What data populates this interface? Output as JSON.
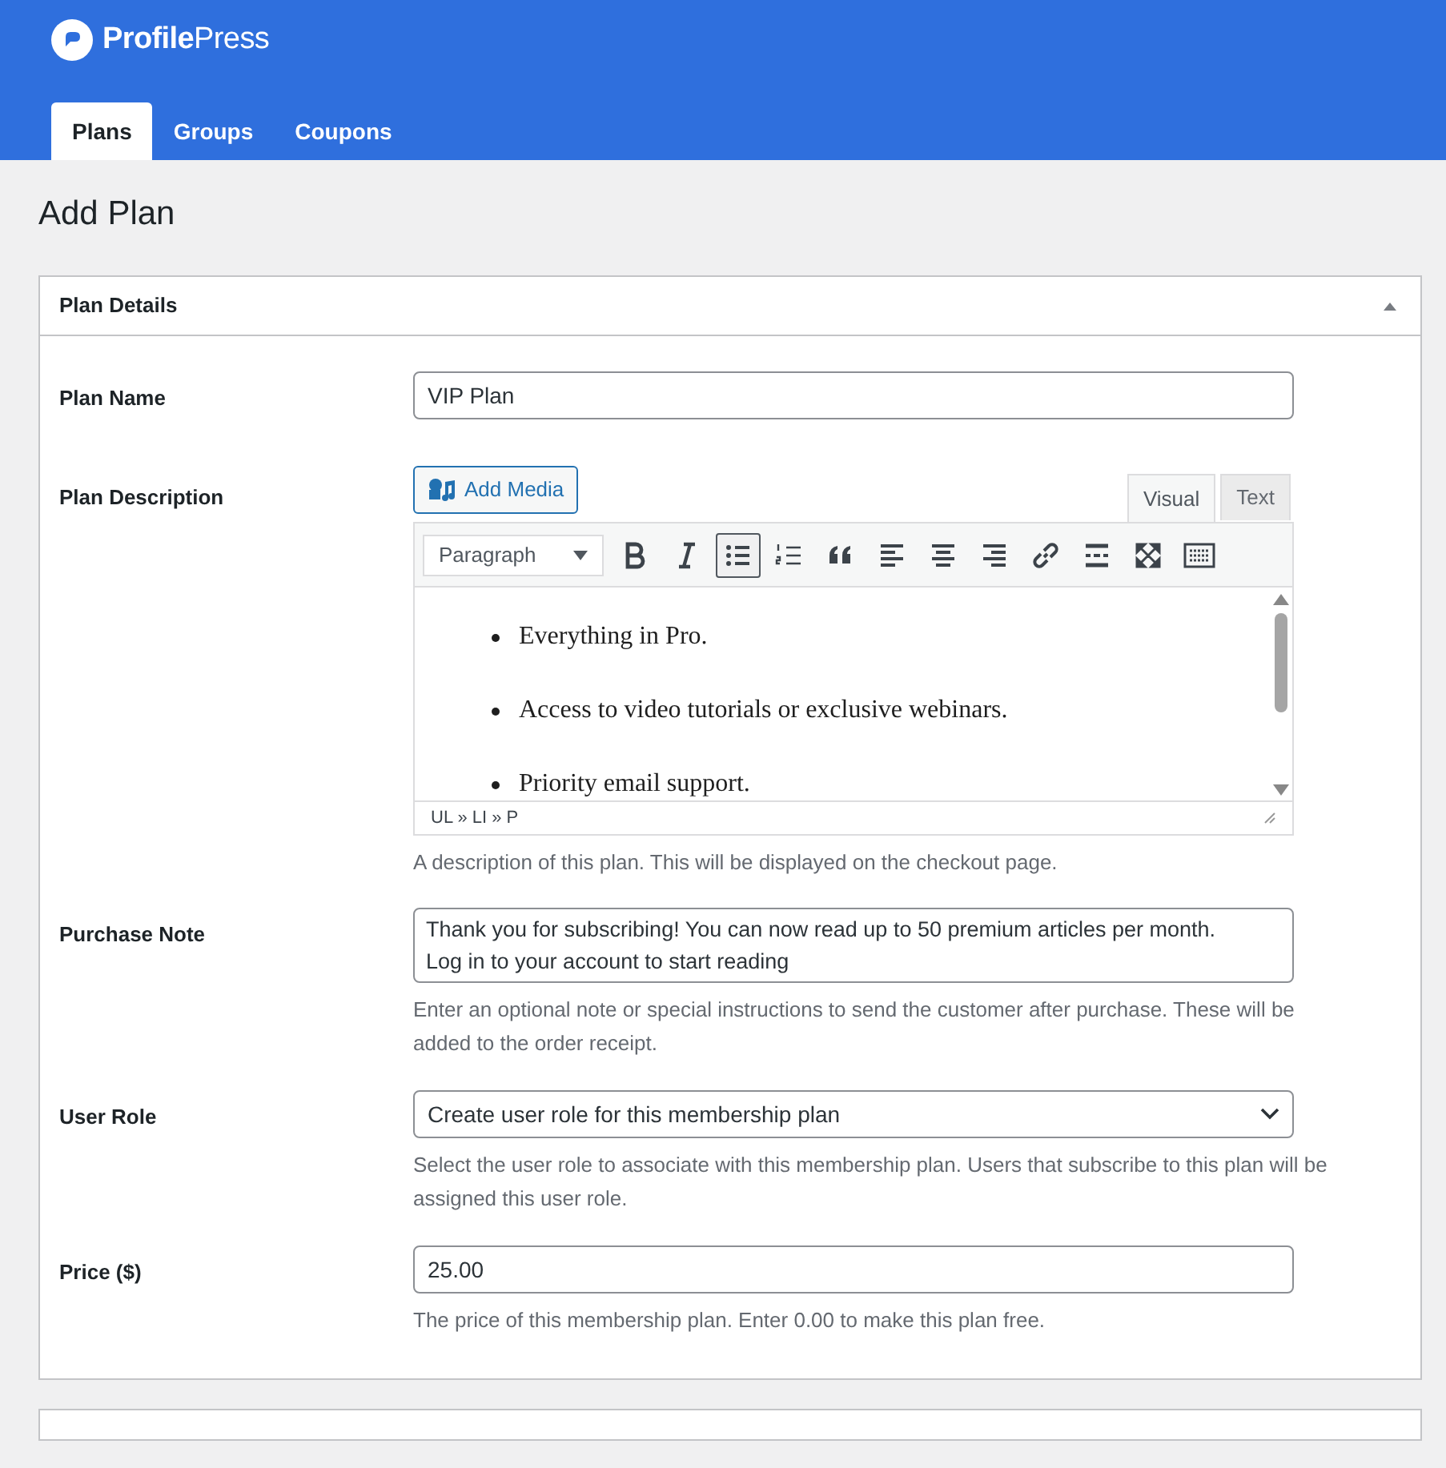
{
  "brand": {
    "name_bold": "Profile",
    "name_light": "Press"
  },
  "tabs": [
    {
      "label": "Plans",
      "selected": true
    },
    {
      "label": "Groups",
      "selected": false
    },
    {
      "label": "Coupons",
      "selected": false
    }
  ],
  "page_title": "Add Plan",
  "panel": {
    "title": "Plan Details",
    "expanded": true
  },
  "plan_name": {
    "label": "Plan Name",
    "value": "VIP Plan"
  },
  "description": {
    "label": "Plan Description",
    "add_media": "Add Media",
    "editor_tabs": [
      {
        "label": "Visual",
        "selected": true
      },
      {
        "label": "Text",
        "selected": false
      }
    ],
    "format_select": "Paragraph",
    "toolbar": [
      {
        "kind": "bold",
        "selected": false
      },
      {
        "kind": "italic",
        "selected": false
      },
      {
        "kind": "bullets",
        "selected": true
      },
      {
        "kind": "numbers",
        "selected": false
      },
      {
        "kind": "quote",
        "selected": false
      },
      {
        "kind": "align-left",
        "selected": false
      },
      {
        "kind": "align-center",
        "selected": false
      },
      {
        "kind": "align-right",
        "selected": false
      },
      {
        "kind": "link",
        "selected": false
      },
      {
        "kind": "more",
        "selected": false
      },
      {
        "kind": "fullscreen",
        "selected": false
      },
      {
        "kind": "keyboard",
        "selected": false
      }
    ],
    "content": [
      "Everything in Pro.",
      "Access to video tutorials or exclusive webinars.",
      "Priority email support."
    ],
    "path": "UL » LI » P",
    "help": "A description of this plan. This will be displayed on the checkout page."
  },
  "purchase_note": {
    "label": "Purchase Note",
    "value": "Thank you for subscribing! You can now read up to 50 premium articles per month.\nLog in to your account to start reading",
    "help": "Enter an optional note or special instructions to send the customer after purchase. These will be added to the order receipt."
  },
  "user_role": {
    "label": "User Role",
    "value": "Create user role for this membership plan",
    "help": "Select the user role to associate with this membership plan. Users that subscribe to this plan will be assigned this user role."
  },
  "price": {
    "label": "Price ($)",
    "value": "25.00",
    "help": "The price of this membership plan. Enter 0.00 to make this plan free."
  }
}
